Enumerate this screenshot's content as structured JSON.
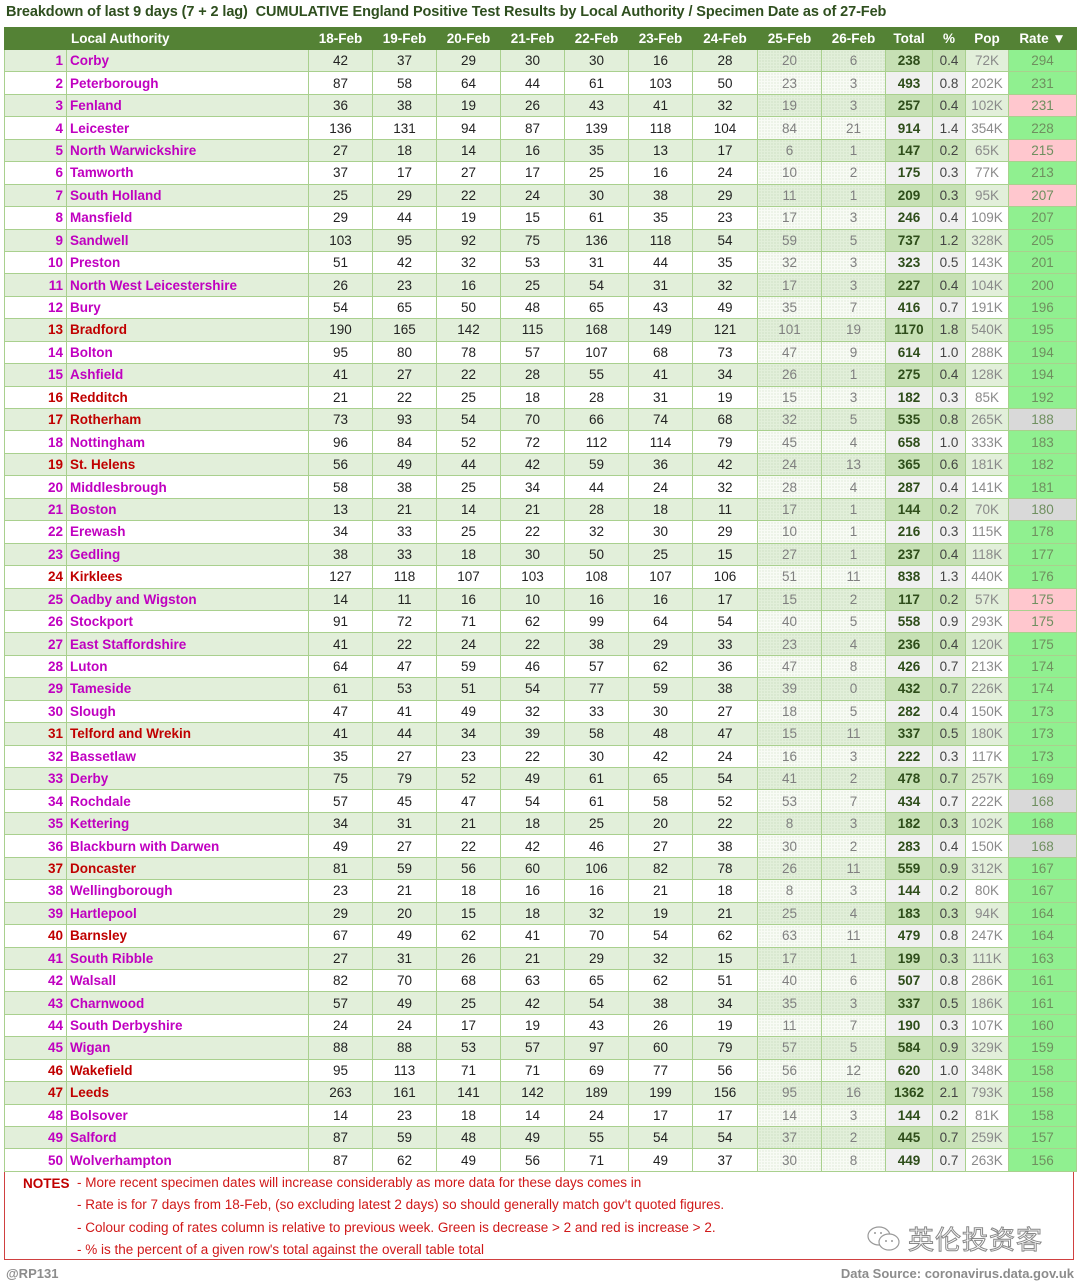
{
  "title": "Breakdown of last 9 days (7 + 2 lag)  CUMULATIVE England Positive Test Results by Local Authority / Specimen Date as of 27-Feb",
  "columns": {
    "name": "Local Authority",
    "dates": [
      "18-Feb",
      "19-Feb",
      "20-Feb",
      "21-Feb",
      "22-Feb",
      "23-Feb",
      "24-Feb",
      "25-Feb",
      "26-Feb"
    ],
    "total": "Total",
    "pct": "%",
    "pop": "Pop",
    "rate": "Rate ▼"
  },
  "colors": {
    "header_bg": "#548235",
    "name_default": "#c000c0",
    "name_highlight": "#c00000",
    "rate_green": "#90f090",
    "rate_red": "#ffc7ce",
    "rate_grey": "#d9d9d9"
  },
  "rows": [
    {
      "rank": "1",
      "name": "Corby",
      "nc": "magenta",
      "d": [
        42,
        37,
        29,
        30,
        30,
        16,
        28,
        20,
        6
      ],
      "total": "238",
      "pct": "0.4",
      "pop": "72K",
      "rate": "294",
      "rc": "green"
    },
    {
      "rank": "2",
      "name": "Peterborough",
      "nc": "magenta",
      "d": [
        87,
        58,
        64,
        44,
        61,
        103,
        50,
        23,
        3
      ],
      "total": "493",
      "pct": "0.8",
      "pop": "202K",
      "rate": "231",
      "rc": "green"
    },
    {
      "rank": "3",
      "name": "Fenland",
      "nc": "magenta",
      "d": [
        36,
        38,
        19,
        26,
        43,
        41,
        32,
        19,
        3
      ],
      "total": "257",
      "pct": "0.4",
      "pop": "102K",
      "rate": "231",
      "rc": "red"
    },
    {
      "rank": "4",
      "name": "Leicester",
      "nc": "magenta",
      "d": [
        136,
        131,
        94,
        87,
        139,
        118,
        104,
        84,
        21
      ],
      "total": "914",
      "pct": "1.4",
      "pop": "354K",
      "rate": "228",
      "rc": "green"
    },
    {
      "rank": "5",
      "name": "North Warwickshire",
      "nc": "magenta",
      "d": [
        27,
        18,
        14,
        16,
        35,
        13,
        17,
        6,
        1
      ],
      "total": "147",
      "pct": "0.2",
      "pop": "65K",
      "rate": "215",
      "rc": "red"
    },
    {
      "rank": "6",
      "name": "Tamworth",
      "nc": "magenta",
      "d": [
        37,
        17,
        27,
        17,
        25,
        16,
        24,
        10,
        2
      ],
      "total": "175",
      "pct": "0.3",
      "pop": "77K",
      "rate": "213",
      "rc": "green"
    },
    {
      "rank": "7",
      "name": "South Holland",
      "nc": "magenta",
      "d": [
        25,
        29,
        22,
        24,
        30,
        38,
        29,
        11,
        1
      ],
      "total": "209",
      "pct": "0.3",
      "pop": "95K",
      "rate": "207",
      "rc": "red"
    },
    {
      "rank": "8",
      "name": "Mansfield",
      "nc": "magenta",
      "d": [
        29,
        44,
        19,
        15,
        61,
        35,
        23,
        17,
        3
      ],
      "total": "246",
      "pct": "0.4",
      "pop": "109K",
      "rate": "207",
      "rc": "green"
    },
    {
      "rank": "9",
      "name": "Sandwell",
      "nc": "magenta",
      "d": [
        103,
        95,
        92,
        75,
        136,
        118,
        54,
        59,
        5
      ],
      "total": "737",
      "pct": "1.2",
      "pop": "328K",
      "rate": "205",
      "rc": "green"
    },
    {
      "rank": "10",
      "name": "Preston",
      "nc": "magenta",
      "d": [
        51,
        42,
        32,
        53,
        31,
        44,
        35,
        32,
        3
      ],
      "total": "323",
      "pct": "0.5",
      "pop": "143K",
      "rate": "201",
      "rc": "green"
    },
    {
      "rank": "11",
      "name": "North West Leicestershire",
      "nc": "magenta",
      "d": [
        26,
        23,
        16,
        25,
        54,
        31,
        32,
        17,
        3
      ],
      "total": "227",
      "pct": "0.4",
      "pop": "104K",
      "rate": "200",
      "rc": "green"
    },
    {
      "rank": "12",
      "name": "Bury",
      "nc": "magenta",
      "d": [
        54,
        65,
        50,
        48,
        65,
        43,
        49,
        35,
        7
      ],
      "total": "416",
      "pct": "0.7",
      "pop": "191K",
      "rate": "196",
      "rc": "green"
    },
    {
      "rank": "13",
      "name": "Bradford",
      "nc": "red",
      "d": [
        190,
        165,
        142,
        115,
        168,
        149,
        121,
        101,
        19
      ],
      "total": "1170",
      "pct": "1.8",
      "pop": "540K",
      "rate": "195",
      "rc": "green"
    },
    {
      "rank": "14",
      "name": "Bolton",
      "nc": "magenta",
      "d": [
        95,
        80,
        78,
        57,
        107,
        68,
        73,
        47,
        9
      ],
      "total": "614",
      "pct": "1.0",
      "pop": "288K",
      "rate": "194",
      "rc": "green"
    },
    {
      "rank": "15",
      "name": "Ashfield",
      "nc": "magenta",
      "d": [
        41,
        27,
        22,
        28,
        55,
        41,
        34,
        26,
        1
      ],
      "total": "275",
      "pct": "0.4",
      "pop": "128K",
      "rate": "194",
      "rc": "green"
    },
    {
      "rank": "16",
      "name": "Redditch",
      "nc": "red",
      "d": [
        21,
        22,
        25,
        18,
        28,
        31,
        19,
        15,
        3
      ],
      "total": "182",
      "pct": "0.3",
      "pop": "85K",
      "rate": "192",
      "rc": "green"
    },
    {
      "rank": "17",
      "name": "Rotherham",
      "nc": "red",
      "d": [
        73,
        93,
        54,
        70,
        66,
        74,
        68,
        32,
        5
      ],
      "total": "535",
      "pct": "0.8",
      "pop": "265K",
      "rate": "188",
      "rc": "grey"
    },
    {
      "rank": "18",
      "name": "Nottingham",
      "nc": "magenta",
      "d": [
        96,
        84,
        52,
        72,
        112,
        114,
        79,
        45,
        4
      ],
      "total": "658",
      "pct": "1.0",
      "pop": "333K",
      "rate": "183",
      "rc": "green"
    },
    {
      "rank": "19",
      "name": "St. Helens",
      "nc": "red",
      "d": [
        56,
        49,
        44,
        42,
        59,
        36,
        42,
        24,
        13
      ],
      "total": "365",
      "pct": "0.6",
      "pop": "181K",
      "rate": "182",
      "rc": "green"
    },
    {
      "rank": "20",
      "name": "Middlesbrough",
      "nc": "magenta",
      "d": [
        58,
        38,
        25,
        34,
        44,
        24,
        32,
        28,
        4
      ],
      "total": "287",
      "pct": "0.4",
      "pop": "141K",
      "rate": "181",
      "rc": "green"
    },
    {
      "rank": "21",
      "name": "Boston",
      "nc": "magenta",
      "d": [
        13,
        21,
        14,
        21,
        28,
        18,
        11,
        17,
        1
      ],
      "total": "144",
      "pct": "0.2",
      "pop": "70K",
      "rate": "180",
      "rc": "grey"
    },
    {
      "rank": "22",
      "name": "Erewash",
      "nc": "magenta",
      "d": [
        34,
        33,
        25,
        22,
        32,
        30,
        29,
        10,
        1
      ],
      "total": "216",
      "pct": "0.3",
      "pop": "115K",
      "rate": "178",
      "rc": "green"
    },
    {
      "rank": "23",
      "name": "Gedling",
      "nc": "magenta",
      "d": [
        38,
        33,
        18,
        30,
        50,
        25,
        15,
        27,
        1
      ],
      "total": "237",
      "pct": "0.4",
      "pop": "118K",
      "rate": "177",
      "rc": "green"
    },
    {
      "rank": "24",
      "name": "Kirklees",
      "nc": "red",
      "d": [
        127,
        118,
        107,
        103,
        108,
        107,
        106,
        51,
        11
      ],
      "total": "838",
      "pct": "1.3",
      "pop": "440K",
      "rate": "176",
      "rc": "green"
    },
    {
      "rank": "25",
      "name": "Oadby and Wigston",
      "nc": "magenta",
      "d": [
        14,
        11,
        16,
        10,
        16,
        16,
        17,
        15,
        2
      ],
      "total": "117",
      "pct": "0.2",
      "pop": "57K",
      "rate": "175",
      "rc": "red"
    },
    {
      "rank": "26",
      "name": "Stockport",
      "nc": "magenta",
      "d": [
        91,
        72,
        71,
        62,
        99,
        64,
        54,
        40,
        5
      ],
      "total": "558",
      "pct": "0.9",
      "pop": "293K",
      "rate": "175",
      "rc": "red"
    },
    {
      "rank": "27",
      "name": "East Staffordshire",
      "nc": "magenta",
      "d": [
        41,
        22,
        24,
        22,
        38,
        29,
        33,
        23,
        4
      ],
      "total": "236",
      "pct": "0.4",
      "pop": "120K",
      "rate": "175",
      "rc": "green"
    },
    {
      "rank": "28",
      "name": "Luton",
      "nc": "magenta",
      "d": [
        64,
        47,
        59,
        46,
        57,
        62,
        36,
        47,
        8
      ],
      "total": "426",
      "pct": "0.7",
      "pop": "213K",
      "rate": "174",
      "rc": "green"
    },
    {
      "rank": "29",
      "name": "Tameside",
      "nc": "magenta",
      "d": [
        61,
        53,
        51,
        54,
        77,
        59,
        38,
        39,
        0
      ],
      "total": "432",
      "pct": "0.7",
      "pop": "226K",
      "rate": "174",
      "rc": "green"
    },
    {
      "rank": "30",
      "name": "Slough",
      "nc": "magenta",
      "d": [
        47,
        41,
        49,
        32,
        33,
        30,
        27,
        18,
        5
      ],
      "total": "282",
      "pct": "0.4",
      "pop": "150K",
      "rate": "173",
      "rc": "green"
    },
    {
      "rank": "31",
      "name": "Telford and Wrekin",
      "nc": "red",
      "d": [
        41,
        44,
        34,
        39,
        58,
        48,
        47,
        15,
        11
      ],
      "total": "337",
      "pct": "0.5",
      "pop": "180K",
      "rate": "173",
      "rc": "green"
    },
    {
      "rank": "32",
      "name": "Bassetlaw",
      "nc": "magenta",
      "d": [
        35,
        27,
        23,
        22,
        30,
        42,
        24,
        16,
        3
      ],
      "total": "222",
      "pct": "0.3",
      "pop": "117K",
      "rate": "173",
      "rc": "green"
    },
    {
      "rank": "33",
      "name": "Derby",
      "nc": "magenta",
      "d": [
        75,
        79,
        52,
        49,
        61,
        65,
        54,
        41,
        2
      ],
      "total": "478",
      "pct": "0.7",
      "pop": "257K",
      "rate": "169",
      "rc": "green"
    },
    {
      "rank": "34",
      "name": "Rochdale",
      "nc": "magenta",
      "d": [
        57,
        45,
        47,
        54,
        61,
        58,
        52,
        53,
        7
      ],
      "total": "434",
      "pct": "0.7",
      "pop": "222K",
      "rate": "168",
      "rc": "grey"
    },
    {
      "rank": "35",
      "name": "Kettering",
      "nc": "magenta",
      "d": [
        34,
        31,
        21,
        18,
        25,
        20,
        22,
        8,
        3
      ],
      "total": "182",
      "pct": "0.3",
      "pop": "102K",
      "rate": "168",
      "rc": "green"
    },
    {
      "rank": "36",
      "name": "Blackburn with Darwen",
      "nc": "magenta",
      "d": [
        49,
        27,
        22,
        42,
        46,
        27,
        38,
        30,
        2
      ],
      "total": "283",
      "pct": "0.4",
      "pop": "150K",
      "rate": "168",
      "rc": "grey"
    },
    {
      "rank": "37",
      "name": "Doncaster",
      "nc": "red",
      "d": [
        81,
        59,
        56,
        60,
        106,
        82,
        78,
        26,
        11
      ],
      "total": "559",
      "pct": "0.9",
      "pop": "312K",
      "rate": "167",
      "rc": "green"
    },
    {
      "rank": "38",
      "name": "Wellingborough",
      "nc": "magenta",
      "d": [
        23,
        21,
        18,
        16,
        16,
        21,
        18,
        8,
        3
      ],
      "total": "144",
      "pct": "0.2",
      "pop": "80K",
      "rate": "167",
      "rc": "green"
    },
    {
      "rank": "39",
      "name": "Hartlepool",
      "nc": "magenta",
      "d": [
        29,
        20,
        15,
        18,
        32,
        19,
        21,
        25,
        4
      ],
      "total": "183",
      "pct": "0.3",
      "pop": "94K",
      "rate": "164",
      "rc": "green"
    },
    {
      "rank": "40",
      "name": "Barnsley",
      "nc": "red",
      "d": [
        67,
        49,
        62,
        41,
        70,
        54,
        62,
        63,
        11
      ],
      "total": "479",
      "pct": "0.8",
      "pop": "247K",
      "rate": "164",
      "rc": "green"
    },
    {
      "rank": "41",
      "name": "South Ribble",
      "nc": "magenta",
      "d": [
        27,
        31,
        26,
        21,
        29,
        32,
        15,
        17,
        1
      ],
      "total": "199",
      "pct": "0.3",
      "pop": "111K",
      "rate": "163",
      "rc": "green"
    },
    {
      "rank": "42",
      "name": "Walsall",
      "nc": "magenta",
      "d": [
        82,
        70,
        68,
        63,
        65,
        62,
        51,
        40,
        6
      ],
      "total": "507",
      "pct": "0.8",
      "pop": "286K",
      "rate": "161",
      "rc": "green"
    },
    {
      "rank": "43",
      "name": "Charnwood",
      "nc": "magenta",
      "d": [
        57,
        49,
        25,
        42,
        54,
        38,
        34,
        35,
        3
      ],
      "total": "337",
      "pct": "0.5",
      "pop": "186K",
      "rate": "161",
      "rc": "green"
    },
    {
      "rank": "44",
      "name": "South Derbyshire",
      "nc": "magenta",
      "d": [
        24,
        24,
        17,
        19,
        43,
        26,
        19,
        11,
        7
      ],
      "total": "190",
      "pct": "0.3",
      "pop": "107K",
      "rate": "160",
      "rc": "green"
    },
    {
      "rank": "45",
      "name": "Wigan",
      "nc": "magenta",
      "d": [
        88,
        88,
        53,
        57,
        97,
        60,
        79,
        57,
        5
      ],
      "total": "584",
      "pct": "0.9",
      "pop": "329K",
      "rate": "159",
      "rc": "green"
    },
    {
      "rank": "46",
      "name": "Wakefield",
      "nc": "red",
      "d": [
        95,
        113,
        71,
        71,
        69,
        77,
        56,
        56,
        12
      ],
      "total": "620",
      "pct": "1.0",
      "pop": "348K",
      "rate": "158",
      "rc": "green"
    },
    {
      "rank": "47",
      "name": "Leeds",
      "nc": "red",
      "d": [
        263,
        161,
        141,
        142,
        189,
        199,
        156,
        95,
        16
      ],
      "total": "1362",
      "pct": "2.1",
      "pop": "793K",
      "rate": "158",
      "rc": "green"
    },
    {
      "rank": "48",
      "name": "Bolsover",
      "nc": "magenta",
      "d": [
        14,
        23,
        18,
        14,
        24,
        17,
        17,
        14,
        3
      ],
      "total": "144",
      "pct": "0.2",
      "pop": "81K",
      "rate": "158",
      "rc": "green"
    },
    {
      "rank": "49",
      "name": "Salford",
      "nc": "magenta",
      "d": [
        87,
        59,
        48,
        49,
        55,
        54,
        54,
        37,
        2
      ],
      "total": "445",
      "pct": "0.7",
      "pop": "259K",
      "rate": "157",
      "rc": "green"
    },
    {
      "rank": "50",
      "name": "Wolverhampton",
      "nc": "magenta",
      "d": [
        87,
        62,
        49,
        56,
        71,
        49,
        37,
        30,
        8
      ],
      "total": "449",
      "pct": "0.7",
      "pop": "263K",
      "rate": "156",
      "rc": "green"
    }
  ],
  "notes": {
    "label": "NOTES",
    "lines": [
      "- More recent specimen dates will increase considerably as more data for these days comes in",
      "- Rate is for 7 days from 18-Feb, (so excluding latest 2 days) so should generally match gov't quoted figures.",
      "- Colour coding of rates column is relative to previous week. Green is decrease > 2 and red is increase > 2.",
      "- % is the percent of a given row's total against the overall table total"
    ]
  },
  "watermark": {
    "icon": "wechat-icon",
    "text": "英伦投资客"
  },
  "footer": {
    "credit": "@RP131",
    "source": "Data Source: coronavirus.data.gov.uk"
  }
}
